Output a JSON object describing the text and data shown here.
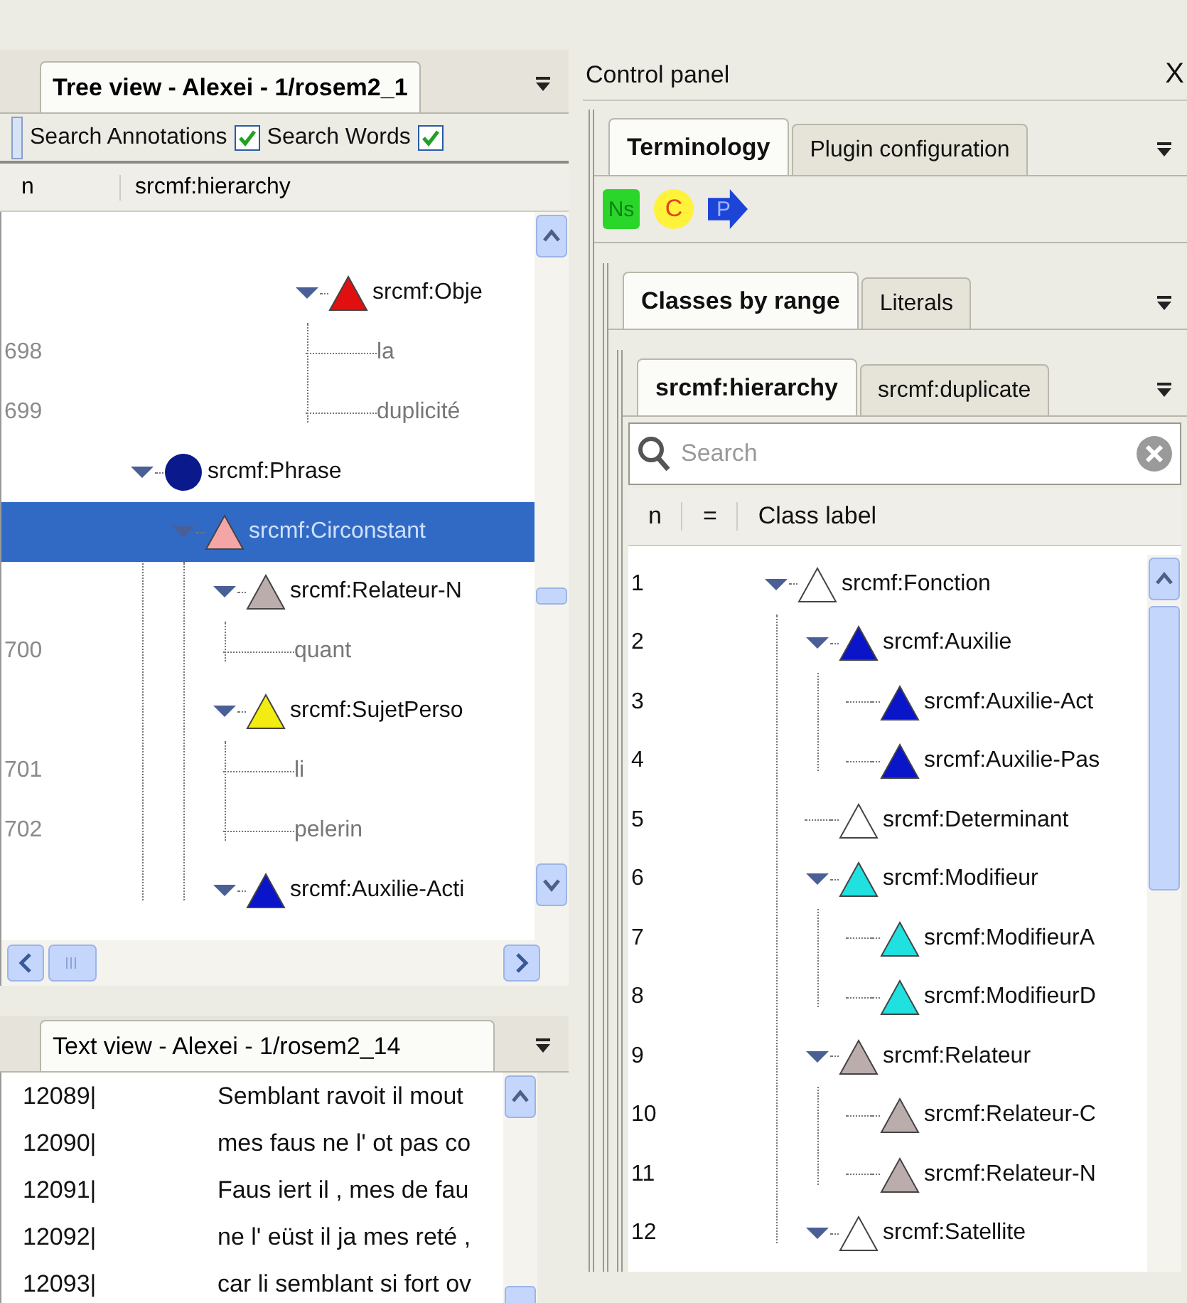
{
  "tree_view": {
    "title": "Tree view - Alexei - 1/rosem2_1",
    "search_options": [
      {
        "label": "Search Annotations",
        "checked": true
      },
      {
        "label": "Search Words",
        "checked": true
      }
    ],
    "columns": [
      "n",
      "srcmf:hierarchy"
    ],
    "rows": [
      {
        "kind": "triangle",
        "label": "srcmf:Obje",
        "color": "#e01010",
        "expanded": true,
        "selected": false,
        "children": [
          {
            "kind": "word",
            "n": "698",
            "label": "la",
            "selected": false
          },
          {
            "kind": "word",
            "n": "699",
            "label": "duplicité",
            "selected": false
          }
        ]
      },
      {
        "kind": "circle",
        "label": "srcmf:Phrase",
        "color": "#0a1a8c",
        "expanded": true,
        "selected": false,
        "children": [
          {
            "kind": "triangle",
            "label": "srcmf:Circonstant",
            "color": "#f4a6a6",
            "expanded": true,
            "selected": true,
            "children": [
              {
                "kind": "triangle",
                "label": "srcmf:Relateur-N",
                "color": "#bcadad",
                "expanded": true,
                "selected": false,
                "children": [
                  {
                    "kind": "word",
                    "n": "700",
                    "label": "quant",
                    "selected": false
                  }
                ]
              },
              {
                "kind": "triangle",
                "label": "srcmf:SujetPerso",
                "color": "#f2ec10",
                "expanded": true,
                "selected": false,
                "children": [
                  {
                    "kind": "word",
                    "n": "701",
                    "label": "li",
                    "selected": false
                  },
                  {
                    "kind": "word",
                    "n": "702",
                    "label": "pelerin",
                    "selected": false
                  }
                ]
              },
              {
                "kind": "triangle",
                "label": "srcmf:Auxilie-Acti",
                "color": "#0a14c8",
                "expanded": true,
                "selected": false
              }
            ]
          }
        ]
      }
    ]
  },
  "text_view": {
    "title": "Text view - Alexei - 1/rosem2_14",
    "lines": [
      {
        "n": "12089|",
        "text": "Semblant ravoit il mout"
      },
      {
        "n": "12090|",
        "text": "mes faus ne l' ot pas co"
      },
      {
        "n": "12091|",
        "text": "Faus iert il , mes de fau"
      },
      {
        "n": "12092|",
        "text": "ne l' eüst il ja mes reté ,"
      },
      {
        "n": "12093|",
        "text": "car li semblant si fort ov"
      }
    ]
  },
  "control_panel": {
    "title": "Control panel",
    "close": "X",
    "tabs": [
      {
        "label": "Terminology",
        "selected": true
      },
      {
        "label": "Plugin configuration",
        "selected": false
      }
    ],
    "tools": [
      {
        "kind": "square",
        "label": "Ns"
      },
      {
        "kind": "circle",
        "label": "C"
      },
      {
        "kind": "arrow",
        "label": "P"
      }
    ],
    "subtabs": [
      {
        "label": "Classes by range",
        "selected": true
      },
      {
        "label": "Literals",
        "selected": false
      }
    ],
    "inner_tabs": [
      {
        "label": "srcmf:hierarchy",
        "selected": true
      },
      {
        "label": "srcmf:duplicate",
        "selected": false
      }
    ],
    "search": {
      "placeholder": "Search"
    },
    "columns": [
      "n",
      "=",
      "Class label"
    ],
    "rows": [
      {
        "kind": "triangle",
        "n": "1",
        "label": "srcmf:Fonction",
        "color": "#ffffff",
        "expanded": true,
        "selected": false,
        "children": [
          {
            "kind": "triangle",
            "n": "2",
            "label": "srcmf:Auxilie",
            "color": "#0a14c8",
            "expanded": true,
            "selected": false,
            "children": [
              {
                "kind": "triangle",
                "n": "3",
                "label": "srcmf:Auxilie-Act",
                "color": "#0a14c8",
                "selected": false
              },
              {
                "kind": "triangle",
                "n": "4",
                "label": "srcmf:Auxilie-Pas",
                "color": "#0a14c8",
                "selected": false
              }
            ]
          },
          {
            "kind": "triangle",
            "n": "5",
            "label": "srcmf:Determinant",
            "color": "#ffffff",
            "selected": false
          },
          {
            "kind": "triangle",
            "n": "6",
            "label": "srcmf:Modifieur",
            "color": "#20e0e0",
            "expanded": true,
            "selected": false,
            "children": [
              {
                "kind": "triangle",
                "n": "7",
                "label": "srcmf:ModifieurA",
                "color": "#20e0e0",
                "selected": false
              },
              {
                "kind": "triangle",
                "n": "8",
                "label": "srcmf:ModifieurD",
                "color": "#20e0e0",
                "selected": false
              }
            ]
          },
          {
            "kind": "triangle",
            "n": "9",
            "label": "srcmf:Relateur",
            "color": "#bcadad",
            "expanded": true,
            "selected": false,
            "children": [
              {
                "kind": "triangle",
                "n": "10",
                "label": "srcmf:Relateur-C",
                "color": "#bcadad",
                "selected": false
              },
              {
                "kind": "triangle",
                "n": "11",
                "label": "srcmf:Relateur-N",
                "color": "#bcadad",
                "selected": false
              }
            ]
          },
          {
            "kind": "triangle",
            "n": "12",
            "label": "srcmf:Satellite",
            "color": "#ffffff",
            "expanded": true,
            "selected": false
          }
        ]
      }
    ]
  }
}
